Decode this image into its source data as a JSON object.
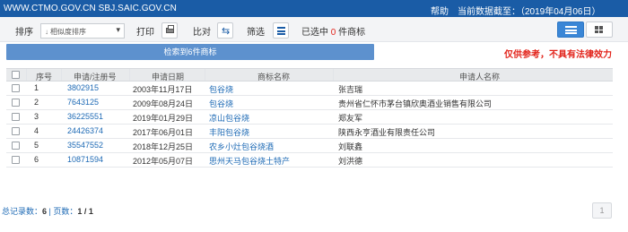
{
  "header": {
    "site": "WWW.CTMO.GOV.CN SBJ.SAIC.GOV.CN",
    "help": "帮助",
    "data_date": "当前数据截至：（2019年04月06日）"
  },
  "toolbar": {
    "sort_label": "排序",
    "sort_value": "相似度排序",
    "print_label": "打印",
    "compare_label": "比对",
    "filter_label": "筛选",
    "selected_prefix": "已选中",
    "selected_count": "0",
    "selected_suffix": "件商标"
  },
  "retrieve_button": "检索到6件商标",
  "disclaimer": "仅供参考，不具有法律效力",
  "table": {
    "columns": [
      "序号",
      "申请/注册号",
      "申请日期",
      "商标名称",
      "申请人名称"
    ],
    "rows": [
      {
        "idx": "1",
        "reg": "3802915",
        "date": "2003年11月17日",
        "name": "包谷烧",
        "applicant": "张吉瑞"
      },
      {
        "idx": "2",
        "reg": "7643125",
        "date": "2009年08月24日",
        "name": "包谷烧",
        "applicant": "贵州省仁怀市茅台镇欣奥酒业销售有限公司"
      },
      {
        "idx": "3",
        "reg": "36225551",
        "date": "2019年01月29日",
        "name": "凉山包谷烧",
        "applicant": "郑友军"
      },
      {
        "idx": "4",
        "reg": "24426374",
        "date": "2017年06月01日",
        "name": "丰阳包谷烧",
        "applicant": "陕西永亨酒业有限责任公司"
      },
      {
        "idx": "5",
        "reg": "35547552",
        "date": "2018年12月25日",
        "name": "农乡小灶包谷烧酒",
        "applicant": "刘联鑫"
      },
      {
        "idx": "6",
        "reg": "10871594",
        "date": "2012年05月07日",
        "name": "思州天马包谷烧土特产",
        "applicant": "刘洪德"
      }
    ]
  },
  "footer": {
    "total_label": "总记录数：",
    "total": "6",
    "separator": " | ",
    "pages_label": "页数：",
    "pages": "1 / 1",
    "page_button": "1"
  }
}
